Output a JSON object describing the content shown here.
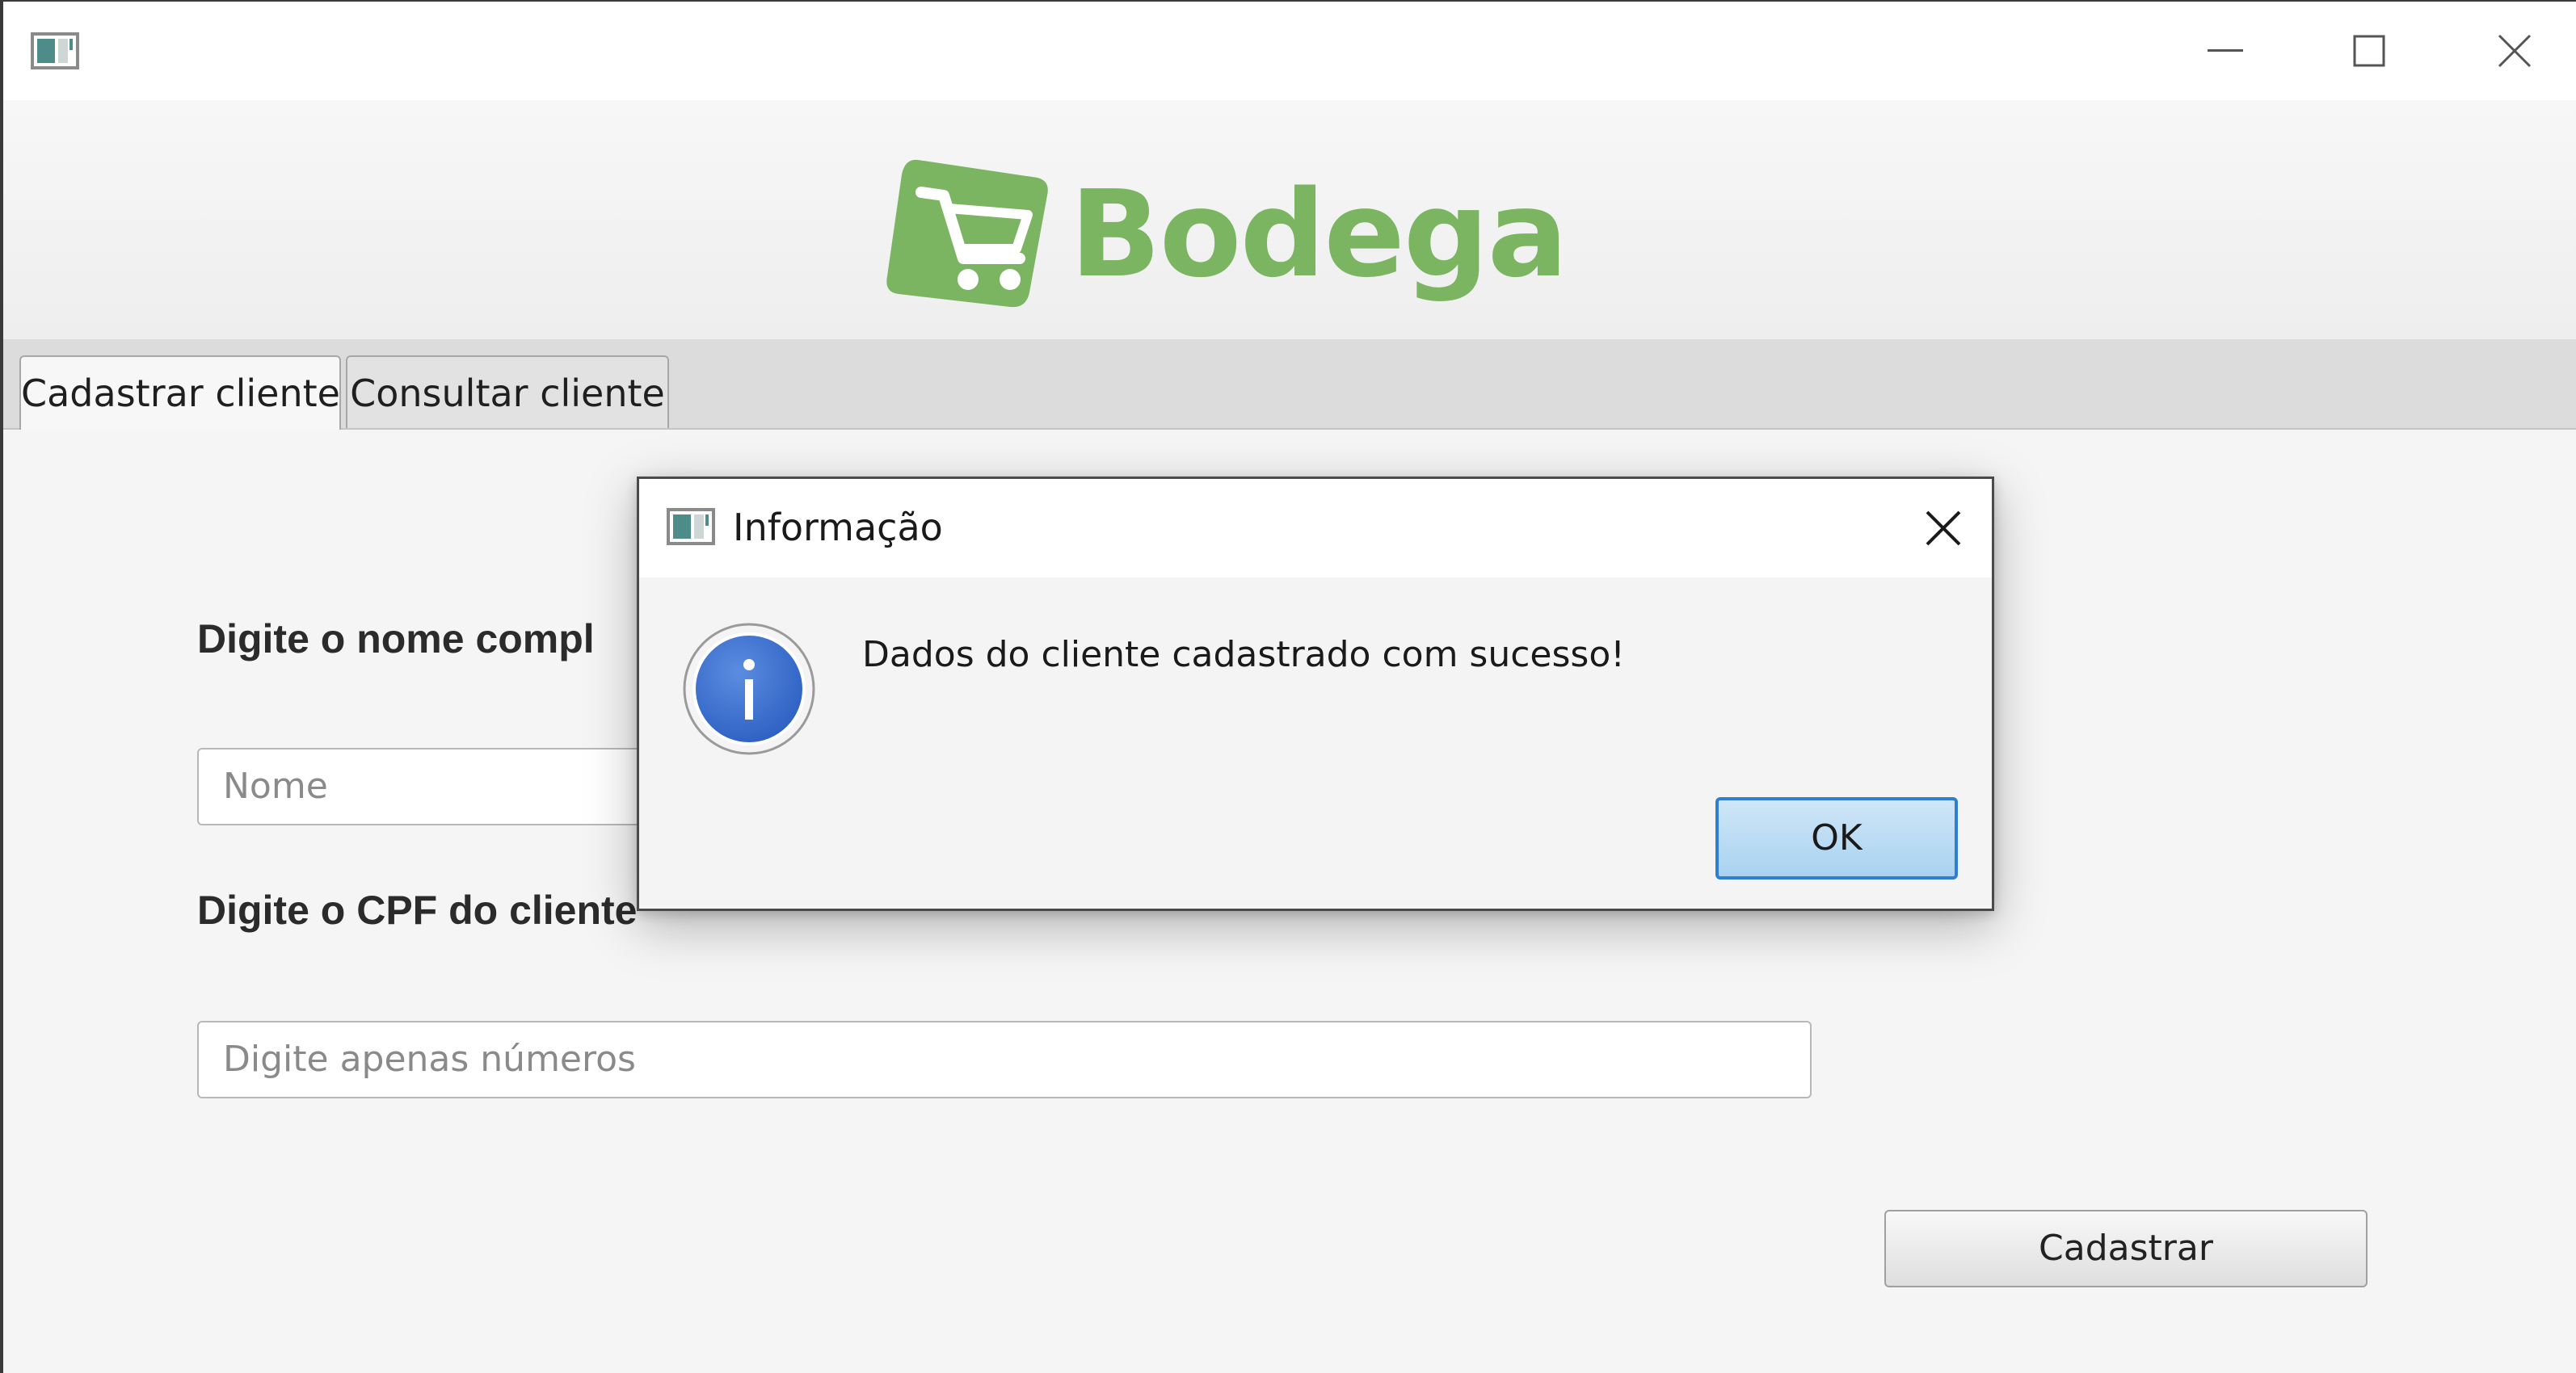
{
  "window": {
    "controls": {
      "minimize": "minimize-icon",
      "maximize": "maximize-icon",
      "close": "close-icon"
    }
  },
  "header": {
    "logo_text": "Bodega",
    "logo_color": "#7cb562"
  },
  "tabs": [
    {
      "label": "Cadastrar cliente",
      "selected": true
    },
    {
      "label": "Consultar cliente",
      "selected": false
    }
  ],
  "form": {
    "name_label": "Digite o nome compl",
    "name_placeholder": "Nome",
    "cpf_label": "Digite o CPF do cliente",
    "cpf_placeholder": "Digite apenas números",
    "submit_label": "Cadastrar"
  },
  "dialog": {
    "title": "Informação",
    "icon": "info-icon",
    "message": "Dados do cliente cadastrado com sucesso!",
    "ok_label": "OK",
    "accent_color": "#2f7fd0"
  }
}
